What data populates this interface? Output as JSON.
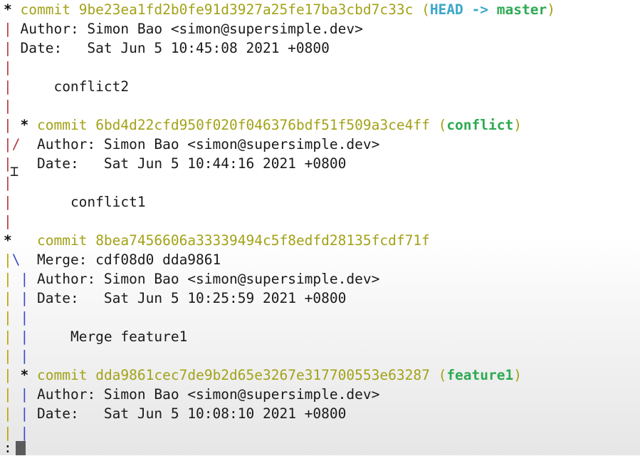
{
  "terminal": {
    "commits": [
      {
        "hash": "9be23ea1fd2b0fe91d3927a25fe17ba3cbd7c33c",
        "refs": {
          "head": "HEAD",
          "arrow": "->",
          "branch": "master"
        },
        "author": "Author: Simon Bao <simon@supersimple.dev>",
        "date": "Date:   Sat Jun 5 10:45:08 2021 +0800",
        "message": "conflict2"
      },
      {
        "hash": "6bd4d22cfd950f020f046376bdf51f509a3ce4ff",
        "refs": {
          "branch": "conflict"
        },
        "author": "Author: Simon Bao <simon@supersimple.dev>",
        "date": "Date:   Sat Jun 5 10:44:16 2021 +0800",
        "message": "conflict1"
      },
      {
        "hash": "8bea7456606a33339494c5f8edfd28135fcdf71f",
        "merge": "Merge: cdf08d0 dda9861",
        "author": "Author: Simon Bao <simon@supersimple.dev>",
        "date": "Date:   Sat Jun 5 10:25:59 2021 +0800",
        "message": "Merge feature1"
      },
      {
        "hash": "dda9861cec7de9b2d65e3267e317700553e63287",
        "refs": {
          "branch": "feature1"
        },
        "author": "Author: Simon Bao <simon@supersimple.dev>",
        "date": "Date:   Sat Jun 5 10:08:10 2021 +0800"
      }
    ],
    "commit_word": "commit",
    "prompt": ":",
    "colors": {
      "hash": "#a3a218",
      "head_ref": "#3aa7c9",
      "branch_ref": "#2eaa53",
      "graph_red": "#b5373d",
      "graph_green": "#2b9b4a",
      "graph_yellow": "#b7a400",
      "graph_blue": "#3b48c6"
    }
  }
}
